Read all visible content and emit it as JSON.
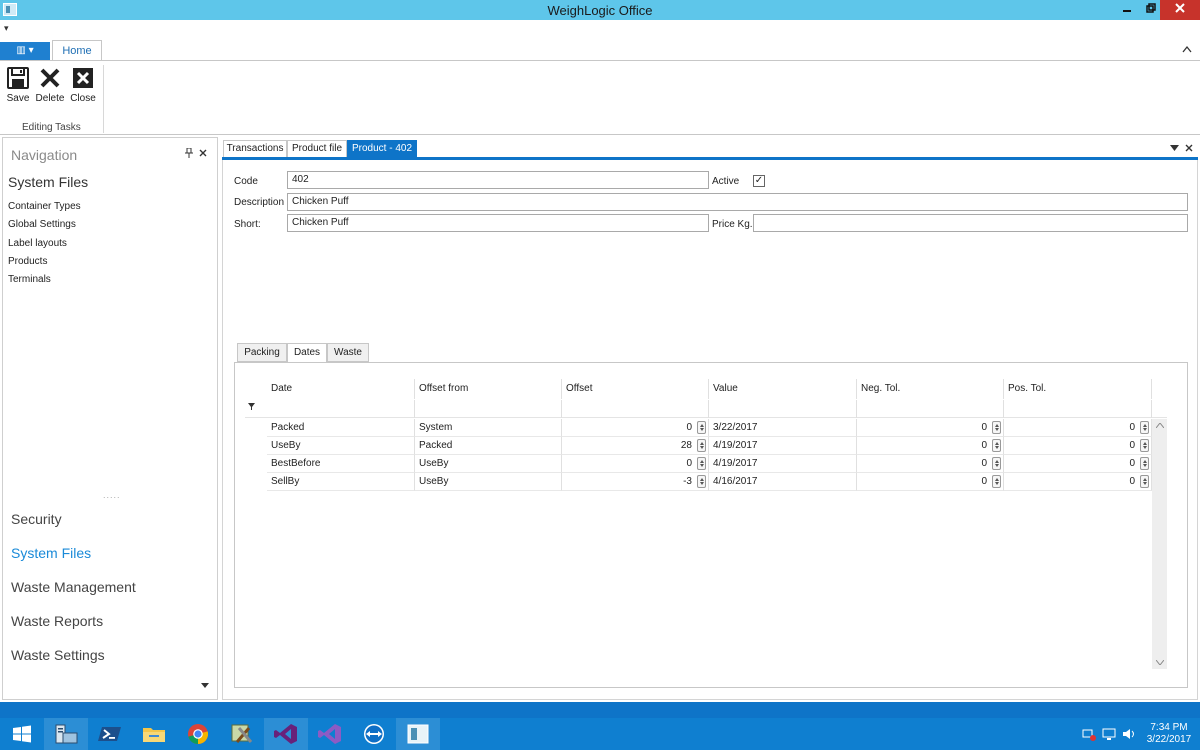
{
  "window": {
    "title": "WeighLogic Office"
  },
  "qat": {
    "dropdown_glyph": "▾"
  },
  "ribbon": {
    "file_menu_glyph": "▥ ▾",
    "tabs": [
      {
        "label": "Home"
      }
    ],
    "buttons": {
      "save": "Save",
      "delete": "Delete",
      "close": "Close"
    },
    "group_label": "Editing Tasks"
  },
  "navigation": {
    "title": "Navigation",
    "section": "System Files",
    "items": [
      "Container Types",
      "Global Settings",
      "Label layouts",
      "Products",
      "Terminals"
    ],
    "grip": ".....",
    "categories": [
      {
        "label": "Security",
        "active": false
      },
      {
        "label": "System Files",
        "active": true
      },
      {
        "label": "Waste Management",
        "active": false
      },
      {
        "label": "Waste Reports",
        "active": false
      },
      {
        "label": "Waste Settings",
        "active": false
      }
    ]
  },
  "doc_tabs": [
    {
      "label": "Transactions",
      "active": false
    },
    {
      "label": "Product file",
      "active": false
    },
    {
      "label": "Product - 402",
      "active": true
    }
  ],
  "product_form": {
    "code_label": "Code",
    "code_value": "402",
    "active_label": "Active",
    "active_checked": true,
    "active_check_glyph": "✓",
    "description_label": "Description",
    "description_value": "Chicken Puff",
    "short_label": "Short:",
    "short_value": "Chicken Puff",
    "price_label": "Price Kg.",
    "price_value": ""
  },
  "inner_tabs": [
    {
      "label": "Packing",
      "active": false
    },
    {
      "label": "Dates",
      "active": true
    },
    {
      "label": "Waste",
      "active": false
    }
  ],
  "dates_grid": {
    "columns": [
      "Date",
      "Offset from",
      "Offset",
      "Value",
      "Neg. Tol.",
      "Pos. Tol."
    ],
    "rows": [
      {
        "date": "Packed",
        "offset_from": "System",
        "offset": "0",
        "value": "3/22/2017",
        "neg_tol": "0",
        "pos_tol": "0"
      },
      {
        "date": "UseBy",
        "offset_from": "Packed",
        "offset": "28",
        "value": "4/19/2017",
        "neg_tol": "0",
        "pos_tol": "0"
      },
      {
        "date": "BestBefore",
        "offset_from": "UseBy",
        "offset": "0",
        "value": "4/19/2017",
        "neg_tol": "0",
        "pos_tol": "0"
      },
      {
        "date": "SellBy",
        "offset_from": "UseBy",
        "offset": "-3",
        "value": "4/16/2017",
        "neg_tol": "0",
        "pos_tol": "0"
      }
    ]
  },
  "taskbar": {
    "apps": [
      "start-icon",
      "server-manager-icon",
      "powershell-icon",
      "file-explorer-icon",
      "chrome-icon",
      "tools-icon",
      "visual-studio-icon",
      "visual-studio-2-icon",
      "teamviewer-icon",
      "weighlogic-icon"
    ],
    "clock_time": "7:34 PM",
    "clock_date": "3/22/2017"
  },
  "colors": {
    "titlebar": "#5ec6ea",
    "accent": "#0e74c8",
    "taskbar": "#0f7fd0",
    "close_button": "#c7332b",
    "active_nav": "#1a8ad8"
  }
}
